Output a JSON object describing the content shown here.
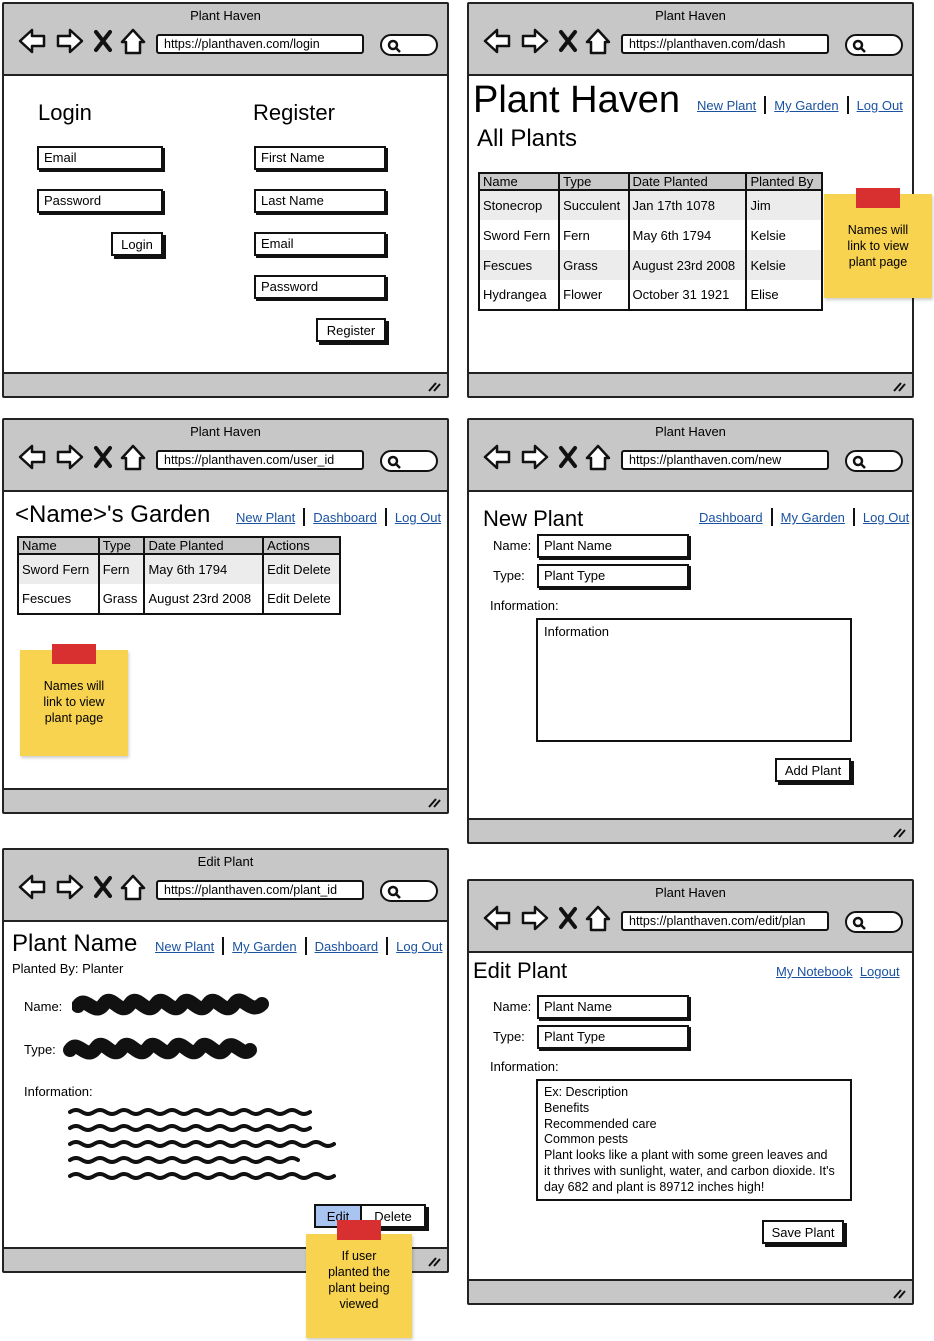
{
  "wireframes": {
    "login": {
      "window_title": "Plant Haven",
      "url": "https://planthaven.com/login",
      "login_heading": "Login",
      "register_heading": "Register",
      "email_placeholder": "Email",
      "password_placeholder": "Password",
      "login_button": "Login",
      "first_name_placeholder": "First Name",
      "last_name_placeholder": "Last Name",
      "register_email_placeholder": "Email",
      "register_password_placeholder": "Password",
      "register_button": "Register"
    },
    "dash": {
      "window_title": "Plant Haven",
      "url": "https://planthaven.com/dash",
      "site_title": "Plant Haven",
      "nav": [
        "New Plant",
        "My Garden",
        "Log Out"
      ],
      "section_title": "All Plants",
      "columns": [
        "Name",
        "Type",
        "Date Planted",
        "Planted By"
      ],
      "rows": [
        [
          "Stonecrop",
          "Succulent",
          "Jan 17th 1078",
          "Jim"
        ],
        [
          "Sword Fern",
          "Fern",
          "May 6th 1794",
          "Kelsie"
        ],
        [
          "Fescues",
          "Grass",
          "August 23rd 2008",
          "Kelsie"
        ],
        [
          "Hydrangea",
          "Flower",
          "October 31 1921",
          "Elise"
        ]
      ],
      "sticky_note": [
        "Names will",
        "link to view",
        "plant page"
      ]
    },
    "garden": {
      "window_title": "Plant Haven",
      "url": "https://planthaven.com/user_id",
      "title": "<Name>'s Garden",
      "nav": [
        "New Plant",
        "Dashboard",
        "Log Out"
      ],
      "columns": [
        "Name",
        "Type",
        "Date Planted",
        "Actions"
      ],
      "rows": [
        [
          "Sword Fern",
          "Fern",
          "May 6th 1794",
          "Edit Delete"
        ],
        [
          "Fescues",
          "Grass",
          "August 23rd 2008",
          "Edit Delete"
        ]
      ],
      "sticky_note": [
        "Names will",
        "link to view",
        "plant page"
      ]
    },
    "new_plant": {
      "window_title": "Plant Haven",
      "url": "https://planthaven.com/new",
      "title": "New Plant",
      "nav": [
        "Dashboard",
        "My Garden",
        "Log Out"
      ],
      "name_label": "Name:",
      "name_placeholder": "Plant Name",
      "type_label": "Type:",
      "type_placeholder": "Plant Type",
      "info_label": "Information:",
      "info_placeholder": "Information",
      "submit_button": "Add Plant"
    },
    "view_plant": {
      "window_title": "Edit Plant",
      "url": "https://planthaven.com/plant_id",
      "title": "Plant Name",
      "nav": [
        "New Plant",
        "My Garden",
        "Dashboard",
        "Log Out"
      ],
      "planted_by": "Planted By: Planter",
      "name_label": "Name:",
      "type_label": "Type:",
      "info_label": "Information:",
      "edit_button": "Edit",
      "delete_button": "Delete",
      "sticky_note": [
        "If user",
        "planted the",
        "plant being",
        "viewed"
      ]
    },
    "edit_plant": {
      "window_title": "Plant Haven",
      "url": "https://planthaven.com/edit/plan",
      "title": "Edit Plant",
      "nav": [
        "My Notebook",
        "Logout"
      ],
      "name_label": "Name:",
      "name_value": "Plant Name",
      "type_label": "Type:",
      "type_value": "Plant Type",
      "info_label": "Information:",
      "info_lines": [
        "Ex: Description",
        "Benefits",
        "Recommended care",
        "Common pests",
        "Plant looks like a plant with some green leaves and",
        "it thrives with sunlight, water, and carbon dioxide. It's",
        "day 682 and plant is 89712 inches high!"
      ],
      "save_button": "Save Plant"
    }
  },
  "colors": {
    "chrome": "#c7c7c7",
    "link": "#1a52a0",
    "sticky": "#f8d350",
    "tape": "#d83030",
    "edit_button": "#a9c4f0",
    "table_header": "#c9c9c9"
  }
}
